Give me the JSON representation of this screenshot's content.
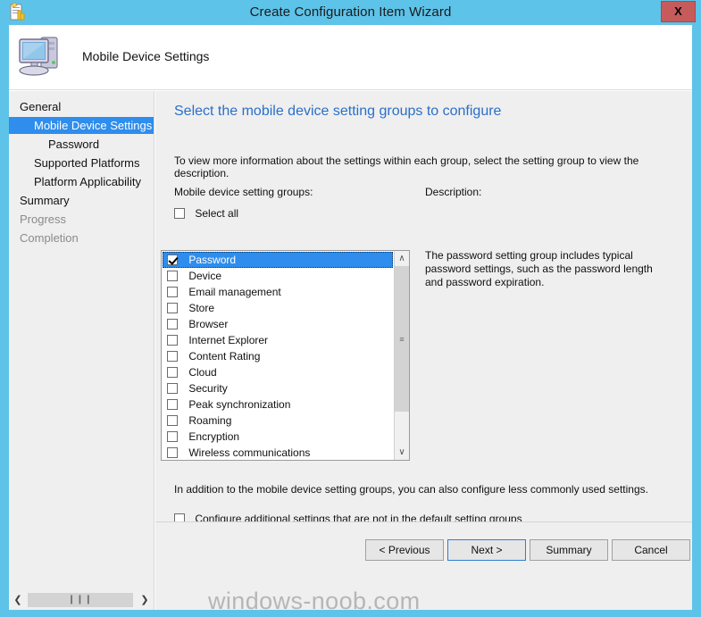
{
  "window": {
    "title": "Create Configuration Item Wizard",
    "close_label": "X",
    "icon": "wizard-document-icon"
  },
  "banner": {
    "title": "Mobile Device Settings",
    "icon": "computer-monitor-icon"
  },
  "sidebar": {
    "items": [
      {
        "label": "General",
        "level": 0,
        "state": "normal"
      },
      {
        "label": "Mobile Device Settings",
        "level": 1,
        "state": "selected"
      },
      {
        "label": "Password",
        "level": 2,
        "state": "normal"
      },
      {
        "label": "Supported Platforms",
        "level": 1,
        "state": "normal"
      },
      {
        "label": "Platform Applicability",
        "level": 1,
        "state": "normal"
      },
      {
        "label": "Summary",
        "level": 0,
        "state": "normal"
      },
      {
        "label": "Progress",
        "level": 0,
        "state": "dim"
      },
      {
        "label": "Completion",
        "level": 0,
        "state": "dim"
      }
    ],
    "hscroll": {
      "left_arrow": "❮",
      "right_arrow": "❯",
      "thumb_grip": "❙❙❙"
    }
  },
  "content": {
    "heading": "Select the mobile device setting groups to configure",
    "intro": "To view more information about the settings within each group, select the setting group to view the description.",
    "groups_label": "Mobile device setting groups:",
    "description_label": "Description:",
    "select_all_label": "Select all",
    "select_all_checked": false,
    "description_body": "The password setting group includes typical password settings, such as the password length and password expiration.",
    "extra_text": "In addition to the mobile device setting groups, you can also configure less commonly used settings.",
    "extra_checkbox_label": "Configure additional settings that are not in the default setting groups",
    "extra_checkbox_checked": false,
    "list_items": [
      {
        "label": "Password",
        "checked": true,
        "selected": true
      },
      {
        "label": "Device",
        "checked": false,
        "selected": false
      },
      {
        "label": "Email management",
        "checked": false,
        "selected": false
      },
      {
        "label": "Store",
        "checked": false,
        "selected": false
      },
      {
        "label": "Browser",
        "checked": false,
        "selected": false
      },
      {
        "label": "Internet Explorer",
        "checked": false,
        "selected": false
      },
      {
        "label": "Content Rating",
        "checked": false,
        "selected": false
      },
      {
        "label": "Cloud",
        "checked": false,
        "selected": false
      },
      {
        "label": "Security",
        "checked": false,
        "selected": false
      },
      {
        "label": "Peak synchronization",
        "checked": false,
        "selected": false
      },
      {
        "label": "Roaming",
        "checked": false,
        "selected": false
      },
      {
        "label": "Encryption",
        "checked": false,
        "selected": false
      },
      {
        "label": "Wireless communications",
        "checked": false,
        "selected": false
      }
    ],
    "listbox_scroll": {
      "up_arrow": "∧",
      "down_arrow": "∨",
      "thumb_grip": "≡"
    }
  },
  "footer": {
    "previous_label": "< Previous",
    "next_label": "Next >",
    "summary_label": "Summary",
    "cancel_label": "Cancel"
  },
  "watermark": "windows-noob.com",
  "colors": {
    "titlebar": "#5ec3e8",
    "close_button": "#c75b5b",
    "heading_blue": "#2a6fc9",
    "selection_blue": "#2e8ded",
    "panel_gray": "#efefef"
  }
}
